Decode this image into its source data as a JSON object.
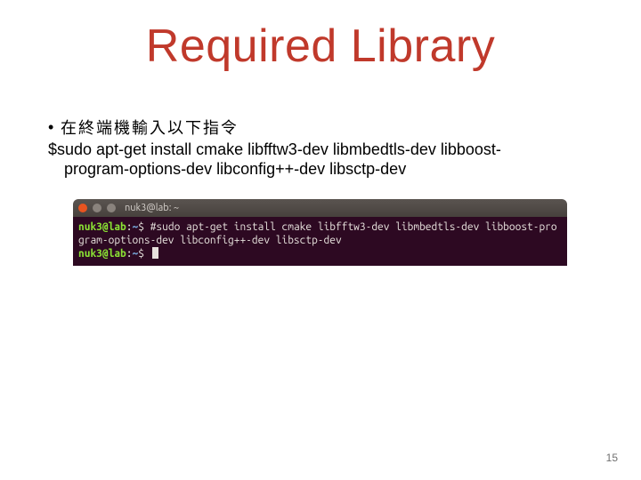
{
  "title": "Required Library",
  "bullet": {
    "dot": "•",
    "text": "在終端機輸入以下指令"
  },
  "command": {
    "line1": "$sudo apt-get install cmake libfftw3-dev libmbedtls-dev libboost-",
    "line2": "program-options-dev libconfig++-dev libsctp-dev"
  },
  "terminal": {
    "window_title": "nuk3@lab: ~",
    "prompt_user": "nuk3@lab",
    "prompt_sep": ":",
    "prompt_path": "~",
    "prompt_end": "$ ",
    "cmd1_part1": "#sudo apt-get install cmake libfftw3-dev libmbedtls-dev libboost-pro",
    "cmd1_part2": "gram-options-dev libconfig++-dev libsctp-dev"
  },
  "page_number": "15"
}
